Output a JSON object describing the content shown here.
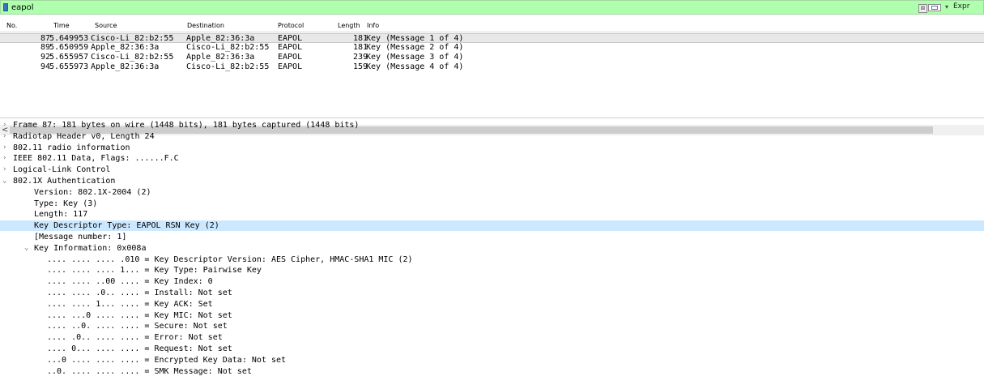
{
  "filter": {
    "value": "eapol",
    "clear_glyph": "⊠",
    "expression_label": "Expr"
  },
  "packet_list": {
    "columns": [
      "No.",
      "Time",
      "Source",
      "Destination",
      "Protocol",
      "Length",
      "Info"
    ],
    "rows": [
      {
        "no": "87",
        "time": "5.649953",
        "source": "Cisco-Li_82:b2:55",
        "destination": "Apple_82:36:3a",
        "protocol": "EAPOL",
        "length": "181",
        "info": "Key (Message 1 of 4)",
        "selected": true
      },
      {
        "no": "89",
        "time": "5.650959",
        "source": "Apple_82:36:3a",
        "destination": "Cisco-Li_82:b2:55",
        "protocol": "EAPOL",
        "length": "181",
        "info": "Key (Message 2 of 4)",
        "selected": false
      },
      {
        "no": "92",
        "time": "5.655957",
        "source": "Cisco-Li_82:b2:55",
        "destination": "Apple_82:36:3a",
        "protocol": "EAPOL",
        "length": "239",
        "info": "Key (Message 3 of 4)",
        "selected": false
      },
      {
        "no": "94",
        "time": "5.655973",
        "source": "Apple_82:36:3a",
        "destination": "Cisco-Li_82:b2:55",
        "protocol": "EAPOL",
        "length": "159",
        "info": "Key (Message 4 of 4)",
        "selected": false
      }
    ]
  },
  "scrollbar": {
    "left_arrow": "<"
  },
  "details": {
    "items": [
      {
        "text": "Frame 87: 181 bytes on wire (1448 bits), 181 bytes captured (1448 bits)",
        "level": 0,
        "arrow": "collapsed"
      },
      {
        "text": "Radiotap Header v0, Length 24",
        "level": 0,
        "arrow": "collapsed"
      },
      {
        "text": "802.11 radio information",
        "level": 0,
        "arrow": "collapsed"
      },
      {
        "text": "IEEE 802.11 Data, Flags: ......F.C",
        "level": 0,
        "arrow": "collapsed"
      },
      {
        "text": "Logical-Link Control",
        "level": 0,
        "arrow": "collapsed"
      },
      {
        "text": "802.1X Authentication",
        "level": 0,
        "arrow": "expanded"
      },
      {
        "text": "Version: 802.1X-2004 (2)",
        "level": 1,
        "arrow": "none"
      },
      {
        "text": "Type: Key (3)",
        "level": 1,
        "arrow": "none"
      },
      {
        "text": "Length: 117",
        "level": 1,
        "arrow": "none"
      },
      {
        "text": "Key Descriptor Type: EAPOL RSN Key (2)",
        "level": 1,
        "arrow": "none",
        "highlighted": true
      },
      {
        "text": "[Message number: 1]",
        "level": 1,
        "arrow": "none"
      },
      {
        "text": "Key Information: 0x008a",
        "level": 1,
        "arrow": "expanded"
      },
      {
        "text": ".... .... .... .010 = Key Descriptor Version: AES Cipher, HMAC-SHA1 MIC (2)",
        "level": 2,
        "arrow": "none"
      },
      {
        "text": ".... .... .... 1... = Key Type: Pairwise Key",
        "level": 2,
        "arrow": "none"
      },
      {
        "text": ".... .... ..00 .... = Key Index: 0",
        "level": 2,
        "arrow": "none"
      },
      {
        "text": ".... .... .0.. .... = Install: Not set",
        "level": 2,
        "arrow": "none"
      },
      {
        "text": ".... .... 1... .... = Key ACK: Set",
        "level": 2,
        "arrow": "none"
      },
      {
        "text": ".... ...0 .... .... = Key MIC: Not set",
        "level": 2,
        "arrow": "none"
      },
      {
        "text": ".... ..0. .... .... = Secure: Not set",
        "level": 2,
        "arrow": "none"
      },
      {
        "text": ".... .0.. .... .... = Error: Not set",
        "level": 2,
        "arrow": "none"
      },
      {
        "text": ".... 0... .... .... = Request: Not set",
        "level": 2,
        "arrow": "none"
      },
      {
        "text": "...0 .... .... .... = Encrypted Key Data: Not set",
        "level": 2,
        "arrow": "none"
      },
      {
        "text": "..0. .... .... .... = SMK Message: Not set",
        "level": 2,
        "arrow": "none"
      }
    ]
  },
  "colors": {
    "filter_valid": "#afffaf",
    "selected_row": "#e8e8e8",
    "highlight": "#cce8ff"
  }
}
